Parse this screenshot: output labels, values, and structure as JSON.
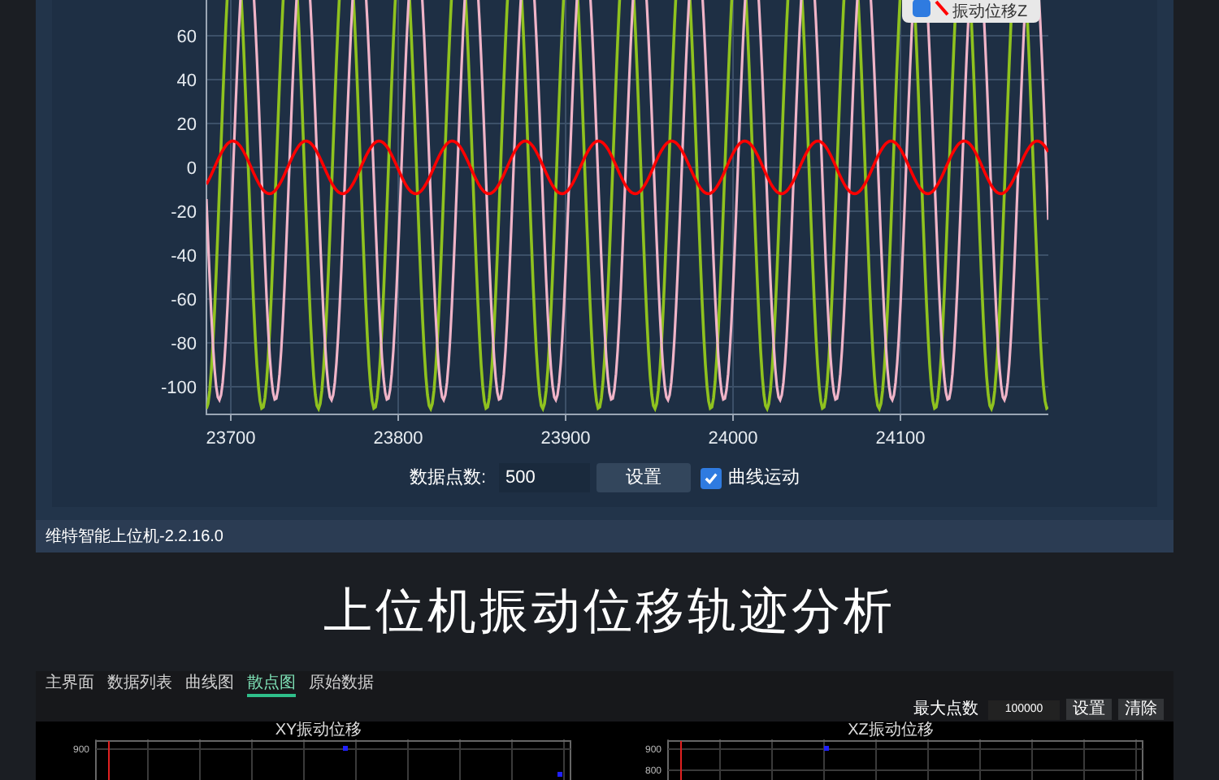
{
  "plot": {
    "legend": [
      {
        "label": "振动位移Z",
        "checked": true,
        "color": "#ff0000"
      }
    ],
    "y_tick_labels": [
      "60",
      "40",
      "20",
      "0",
      "-20",
      "-40",
      "-60",
      "-80",
      "-100"
    ],
    "x_tick_labels": [
      "23700",
      "23800",
      "23900",
      "24000",
      "24100"
    ]
  },
  "controls": {
    "points_label": "数据点数:",
    "points_value": "500",
    "set_button": "设置",
    "motion_label": "曲线运动",
    "motion_checked": true
  },
  "status_bar": "维特智能上位机-2.2.16.0",
  "headline": "上位机振动位移轨迹分析",
  "second_window": {
    "tabs": [
      {
        "label": "主界面",
        "selected": false
      },
      {
        "label": "数据列表",
        "selected": false
      },
      {
        "label": "曲线图",
        "selected": false
      },
      {
        "label": "散点图",
        "selected": true
      },
      {
        "label": "原始数据",
        "selected": false
      }
    ],
    "max_points_label": "最大点数",
    "max_points_value": "100000",
    "set_button": "设置",
    "clear_button": "清除",
    "charts": [
      {
        "title": "XY振动位移",
        "y_tick_labels": [
          "900"
        ]
      },
      {
        "title": "XZ振动位移",
        "y_tick_labels": [
          "900",
          "800"
        ]
      }
    ]
  }
}
